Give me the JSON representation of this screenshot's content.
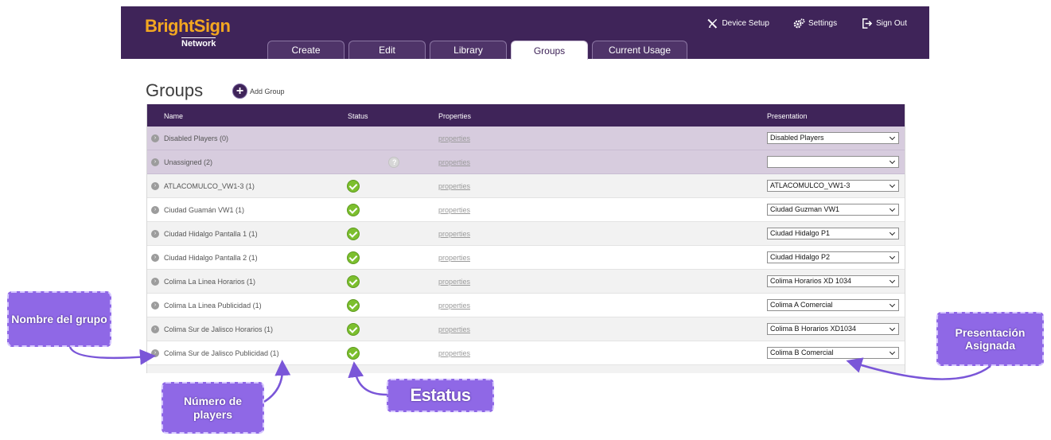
{
  "app": {
    "logo": {
      "brand": "BrightSign",
      "sub": "Network"
    },
    "top_nav": [
      {
        "label": "Device Setup",
        "icon": "tools-icon"
      },
      {
        "label": "Settings",
        "icon": "gears-icon"
      },
      {
        "label": "Sign Out",
        "icon": "sign-out-icon"
      }
    ],
    "tabs": [
      {
        "label": "Create",
        "active": false
      },
      {
        "label": "Edit",
        "active": false
      },
      {
        "label": "Library",
        "active": false
      },
      {
        "label": "Groups",
        "active": true
      },
      {
        "label": "Current Usage",
        "active": false
      }
    ],
    "page_title": "Groups",
    "add_group_label": "Add Group",
    "add_group_symbol": "+"
  },
  "table": {
    "headers": {
      "name": "Name",
      "status": "Status",
      "properties": "Properties",
      "presentation": "Presentation"
    },
    "rows": [
      {
        "name": "Disabled Players (0)",
        "status": "none",
        "properties": "properties",
        "presentation": "Disabled Players",
        "style": "disabled"
      },
      {
        "name": "Unassigned (2)",
        "status": "unknown",
        "properties": "properties",
        "presentation": "",
        "style": "disabled"
      },
      {
        "name": "ATLACOMULCO_VW1-3 (1)",
        "status": "ok",
        "properties": "properties",
        "presentation": "ATLACOMULCO_VW1-3",
        "style": "alt"
      },
      {
        "name": "Ciudad Guamán VW1 (1)",
        "status": "ok",
        "properties": "properties",
        "presentation": "Ciudad Guzman VW1",
        "style": "plain"
      },
      {
        "name": "Ciudad Hidalgo Pantalla 1 (1)",
        "status": "ok",
        "properties": "properties",
        "presentation": "Ciudad Hidalgo P1",
        "style": "alt"
      },
      {
        "name": "Ciudad Hidalgo Pantalla 2 (1)",
        "status": "ok",
        "properties": "properties",
        "presentation": "Ciudad Hidalgo P2",
        "style": "plain"
      },
      {
        "name": "Colima La Linea Horarios (1)",
        "status": "ok",
        "properties": "properties",
        "presentation": "Colima Horarios XD 1034",
        "style": "alt"
      },
      {
        "name": "Colima La Linea Publicidad (1)",
        "status": "ok",
        "properties": "properties",
        "presentation": "Colima A Comercial",
        "style": "plain"
      },
      {
        "name": "Colima Sur de Jalisco Horarios (1)",
        "status": "ok",
        "properties": "properties",
        "presentation": "Colima B Horarios XD1034",
        "style": "alt"
      },
      {
        "name": "Colima Sur de Jalisco Publicidad (1)",
        "status": "ok",
        "properties": "properties",
        "presentation": "Colima B Comercial",
        "style": "plain"
      }
    ]
  },
  "callouts": {
    "name": "Nombre del grupo",
    "players": "Número de players",
    "status": "Estatus",
    "presentation": "Presentación Asignada"
  },
  "colors": {
    "header_purple": "#3f2459",
    "logo_orange": "#f3a721",
    "callout_purple": "#8f68e6",
    "status_green": "#7cbf2e"
  }
}
